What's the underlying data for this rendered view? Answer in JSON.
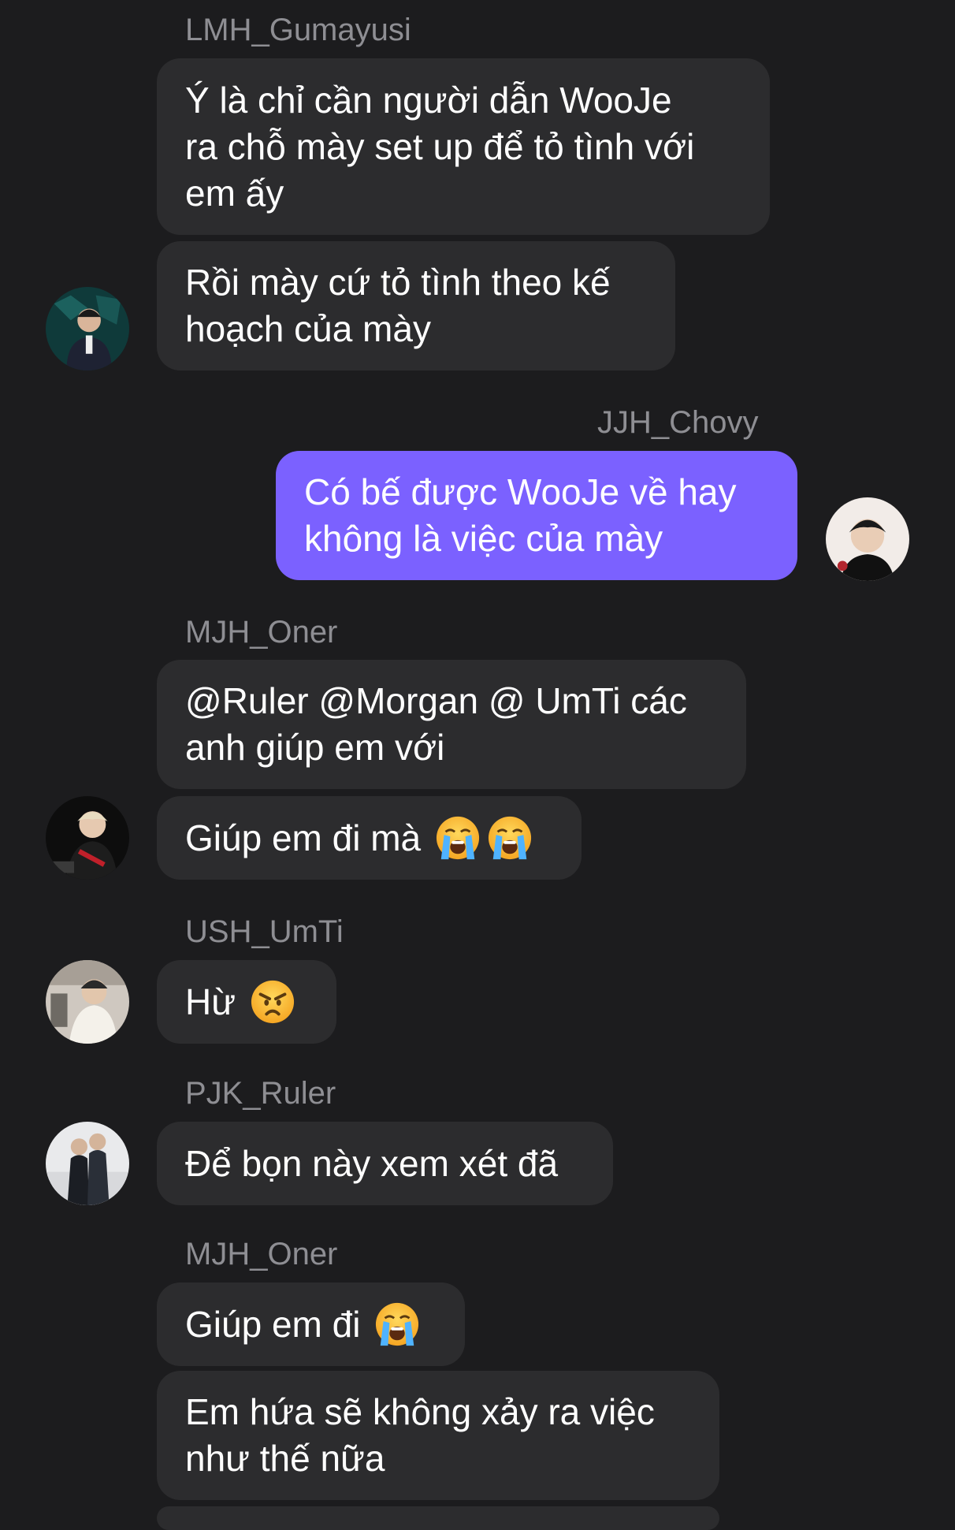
{
  "messages": [
    {
      "sender": "LMH_Gumayusi",
      "text": "Ý là chỉ cần người dẫn WooJe\nra chỗ mày set up để tỏ tình với\nem ấy"
    },
    {
      "sender": "LMH_Gumayusi",
      "text": "Rồi mày cứ tỏ tình theo kế\nhoạch của mày"
    },
    {
      "sender": "JJH_Chovy",
      "text": "Có bế được WooJe về hay\nkhông là việc của mày"
    },
    {
      "sender": "MJH_Oner",
      "text": "@Ruler @Morgan @ UmTi các\nanh giúp em với"
    },
    {
      "sender": "MJH_Oner",
      "text": "Giúp em đi mà",
      "emojis": [
        "loudly-crying-face",
        "loudly-crying-face"
      ]
    },
    {
      "sender": "USH_UmTi",
      "text": "Hừ",
      "emojis": [
        "angry-face"
      ]
    },
    {
      "sender": "PJK_Ruler",
      "text": "Để bọn này xem xét đã"
    },
    {
      "sender": "MJH_Oner",
      "text": "Giúp em đi",
      "emojis": [
        "loudly-crying-face"
      ]
    },
    {
      "sender": "MJH_Oner",
      "text": "Em hứa sẽ không xảy ra việc\nnhư thế nữa"
    }
  ],
  "colors": {
    "background": "#1c1c1e",
    "incoming_bubble": "#2c2c2e",
    "outgoing_bubble": "#7b61ff",
    "sender_name": "#8e8e93",
    "text": "#ffffff"
  },
  "avatars": [
    "avatar-gumayusi",
    "avatar-chovy",
    "avatar-oner",
    "avatar-umti",
    "avatar-ruler"
  ]
}
